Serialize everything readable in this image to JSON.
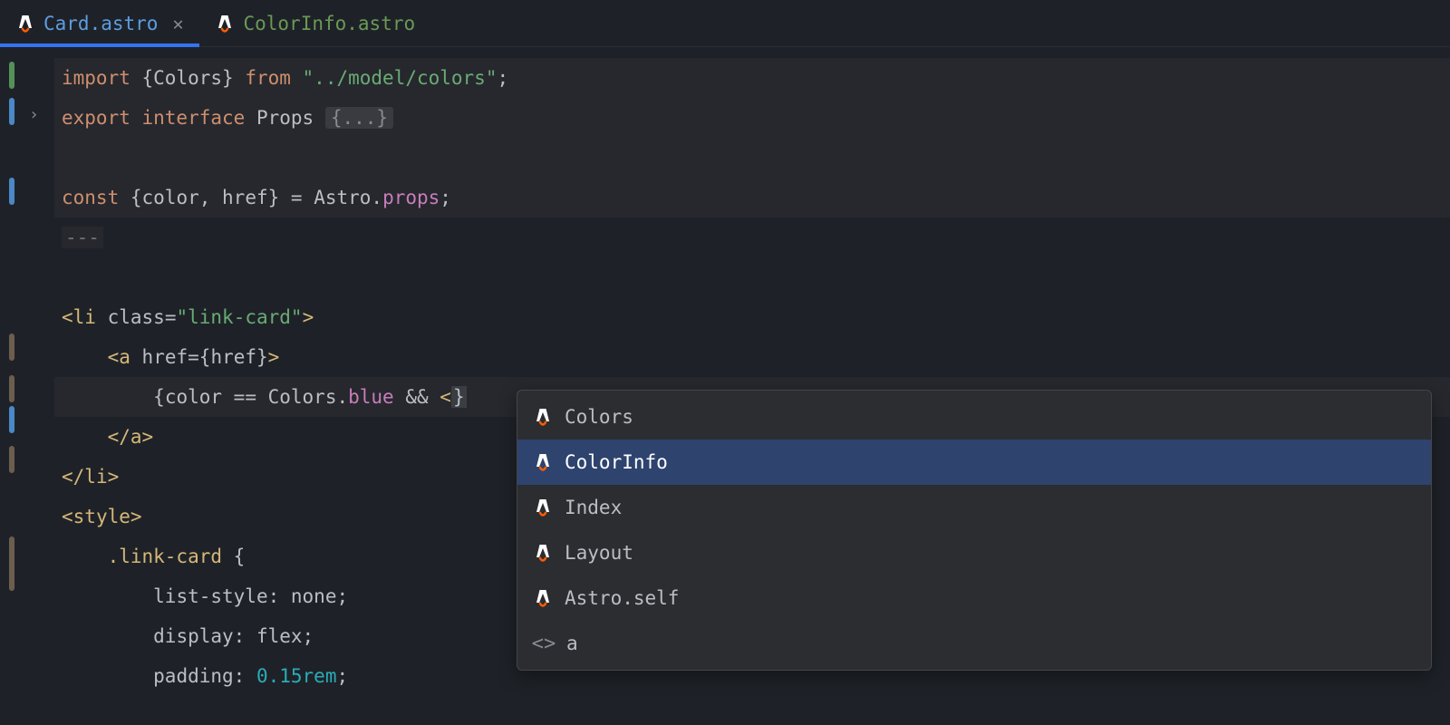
{
  "tabs": [
    {
      "label": "Card.astro",
      "active": true
    },
    {
      "label": "ColorInfo.astro",
      "active": false
    }
  ],
  "code": {
    "line1": {
      "kw1": "import",
      "br1": " {",
      "name": "Colors",
      "br2": "} ",
      "kw2": "from",
      "str": " \"../model/colors\"",
      "semi": ";"
    },
    "line2": {
      "kw1": "export",
      "kw2": " interface",
      "name": " Props ",
      "fold": "{...}"
    },
    "line4": {
      "kw": "const",
      "br1": " {",
      "n1": "color",
      "c": ", ",
      "n2": "href",
      "br2": "} = ",
      "obj": "Astro",
      "dot": ".",
      "prop": "props",
      "semi": ";"
    },
    "line5": {
      "delim": "---"
    },
    "line7": {
      "lt": "<",
      "tag": "li",
      "sp": " ",
      "attr": "class",
      "eq": "=",
      "val": "\"link-card\"",
      "gt": ">"
    },
    "line8": {
      "indent": "    ",
      "lt": "<",
      "tag": "a",
      "sp": " ",
      "attr": "href",
      "eq": "=",
      "br1": "{",
      "expr": "href",
      "br2": "}",
      "gt": ">"
    },
    "line9": {
      "indent": "        ",
      "br1": "{",
      "n1": "color",
      "op": " == ",
      "obj": "Colors",
      "dot": ".",
      "prop": "blue",
      "and": " && ",
      "lt": "<",
      "br2": "}"
    },
    "line10": {
      "indent": "    ",
      "lt": "</",
      "tag": "a",
      "gt": ">"
    },
    "line11": {
      "lt": "</",
      "tag": "li",
      "gt": ">"
    },
    "line12": {
      "lt": "<",
      "tag": "style",
      "gt": ">"
    },
    "line13": {
      "indent": "    ",
      "sel": ".link-card",
      "sp": " ",
      "br": "{"
    },
    "line14": {
      "indent": "        ",
      "prop": "list-style",
      "c": ": ",
      "val": "none",
      "semi": ";"
    },
    "line15": {
      "indent": "        ",
      "prop": "display",
      "c": ": ",
      "val": "flex",
      "semi": ";"
    },
    "line16": {
      "indent": "        ",
      "prop": "padding",
      "c": ": ",
      "val": "0.15rem",
      "semi": ";"
    }
  },
  "completions": [
    {
      "label": "Colors",
      "icon": "astro",
      "selected": false
    },
    {
      "label": "ColorInfo",
      "icon": "astro",
      "selected": true
    },
    {
      "label": "Index",
      "icon": "astro",
      "selected": false
    },
    {
      "label": "Layout",
      "icon": "astro",
      "selected": false
    },
    {
      "label": "Astro.self",
      "icon": "astro",
      "selected": false
    },
    {
      "label": "a",
      "icon": "tag",
      "selected": false
    }
  ]
}
